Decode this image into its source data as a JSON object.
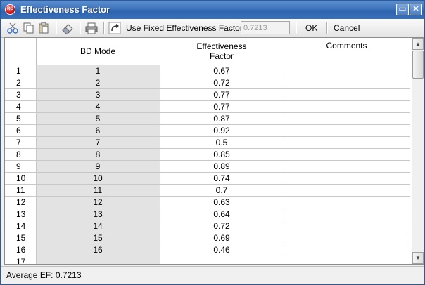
{
  "window": {
    "title": "Effectiveness Factor",
    "app_icon_text": "RG",
    "minimize_symbol": "▭",
    "close_symbol": "✕"
  },
  "toolbar": {
    "icons": [
      "cut-icon",
      "copy-icon",
      "paste-icon",
      "eraser-icon",
      "print-icon",
      "redo-icon"
    ],
    "fixed_label": "Use Fixed Effectiveness Factor",
    "fixed_value": "0.7213",
    "ok_label": "OK",
    "cancel_label": "Cancel"
  },
  "grid": {
    "headers": [
      "",
      "BD Mode",
      "Effectiveness\nFactor",
      "Comments"
    ],
    "rows": [
      {
        "num": "1",
        "bd": "1",
        "ef": "0.67",
        "comment": ""
      },
      {
        "num": "2",
        "bd": "2",
        "ef": "0.72",
        "comment": ""
      },
      {
        "num": "3",
        "bd": "3",
        "ef": "0.77",
        "comment": ""
      },
      {
        "num": "4",
        "bd": "4",
        "ef": "0.77",
        "comment": ""
      },
      {
        "num": "5",
        "bd": "5",
        "ef": "0.87",
        "comment": ""
      },
      {
        "num": "6",
        "bd": "6",
        "ef": "0.92",
        "comment": ""
      },
      {
        "num": "7",
        "bd": "7",
        "ef": "0.5",
        "comment": ""
      },
      {
        "num": "8",
        "bd": "8",
        "ef": "0.85",
        "comment": ""
      },
      {
        "num": "9",
        "bd": "9",
        "ef": "0.89",
        "comment": ""
      },
      {
        "num": "10",
        "bd": "10",
        "ef": "0.74",
        "comment": ""
      },
      {
        "num": "11",
        "bd": "11",
        "ef": "0.7",
        "comment": ""
      },
      {
        "num": "12",
        "bd": "12",
        "ef": "0.63",
        "comment": ""
      },
      {
        "num": "13",
        "bd": "13",
        "ef": "0.64",
        "comment": ""
      },
      {
        "num": "14",
        "bd": "14",
        "ef": "0.72",
        "comment": ""
      },
      {
        "num": "15",
        "bd": "15",
        "ef": "0.69",
        "comment": ""
      },
      {
        "num": "16",
        "bd": "16",
        "ef": "0.46",
        "comment": ""
      },
      {
        "num": "17",
        "bd": "",
        "ef": "",
        "comment": ""
      }
    ]
  },
  "status": {
    "average_text": "Average EF: 0.7213"
  },
  "colors": {
    "titlebar": "#3e73bd",
    "bd_column_bg": "#e3e3e3"
  }
}
